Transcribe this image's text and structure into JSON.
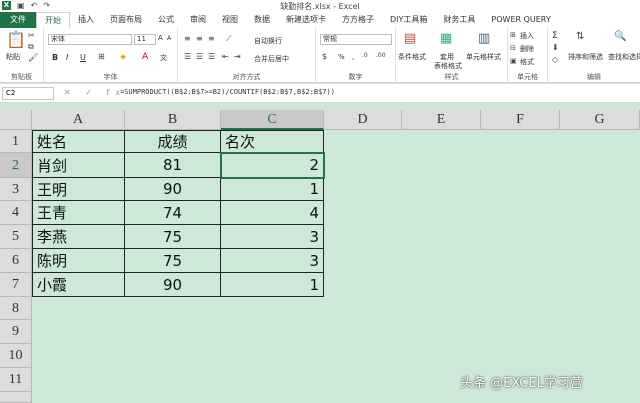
{
  "window": {
    "title": "缺勤排名.xlsx - Excel"
  },
  "tabs": [
    "文件",
    "开始",
    "插入",
    "页面布局",
    "公式",
    "审阅",
    "视图",
    "数据",
    "新建选项卡",
    "方方格子",
    "DIY工具箱",
    "财务工具",
    "POWER QUERY"
  ],
  "ribbon": {
    "clipboard": {
      "paste": "粘贴",
      "label": "剪贴板"
    },
    "font": {
      "name": "宋体",
      "size": "11",
      "label": "字体",
      "bold": "B",
      "italic": "I",
      "underline": "U",
      "color_a": "A",
      "grow": "A",
      "shrink": "A",
      "wen": "文"
    },
    "alignment": {
      "wrap": "自动换行",
      "merge": "合并后居中",
      "label": "对齐方式"
    },
    "number": {
      "format": "常规",
      "label": "数字",
      "percent": "%",
      "comma": ","
    },
    "styles": {
      "conditional": "条件格式",
      "table_line1": "套用",
      "table_line2": "表格格式",
      "cell_styles": "单元格样式",
      "label": "样式"
    },
    "cells": {
      "insert": "插入",
      "delete": "删除",
      "format": "格式",
      "label": "单元格"
    },
    "editing": {
      "sort": "排序和筛选",
      "find": "查找和选择",
      "label": "编辑",
      "sigma": "Σ"
    }
  },
  "formula_bar": {
    "name_box": "C2",
    "formula": "=SUMPRODUCT((B$2:B$7>=B2)/COUNTIF(B$2:B$7,B$2:B$7))",
    "icons": "✕ ✓ fx"
  },
  "columns": [
    "A",
    "B",
    "C",
    "D",
    "E",
    "F",
    "G"
  ],
  "rows": [
    "1",
    "2",
    "3",
    "4",
    "5",
    "6",
    "7",
    "8",
    "9",
    "10",
    "11"
  ],
  "table": {
    "headers": [
      "姓名",
      "成绩",
      "名次"
    ],
    "rows": [
      [
        "肖剑",
        "81",
        "2"
      ],
      [
        "王明",
        "90",
        "1"
      ],
      [
        "王青",
        "74",
        "4"
      ],
      [
        "李燕",
        "75",
        "3"
      ],
      [
        "陈明",
        "75",
        "3"
      ],
      [
        "小霞",
        "90",
        "1"
      ]
    ]
  },
  "watermark": "头条 @EXCEL学习营",
  "colors": {
    "accent": "#217346",
    "sheet_bg": "#cde8d6"
  }
}
